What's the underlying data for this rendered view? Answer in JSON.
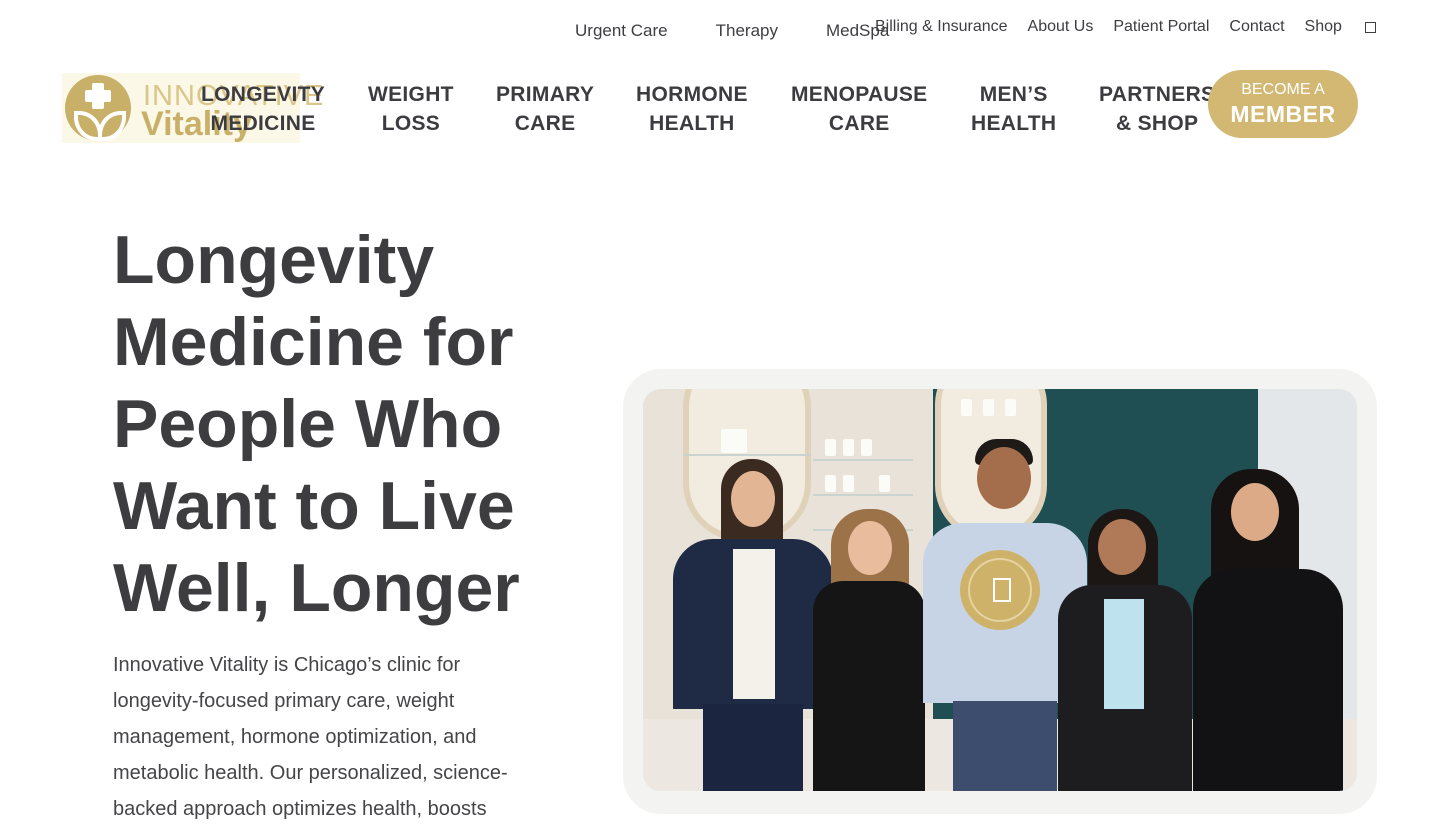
{
  "utility_nav": {
    "left": [
      "Urgent Care",
      "Therapy",
      "MedSpa"
    ],
    "right": [
      "Billing & Insurance",
      "About Us",
      "Patient Portal",
      "Contact",
      "Shop"
    ],
    "extra_icon": "square-icon"
  },
  "logo": {
    "line1": "INNOVATIVE",
    "line2": "Vitality",
    "icon": "cross-leaf-logo-icon"
  },
  "main_nav": [
    {
      "line1": "LONGEVITY",
      "line2": "MEDICINE"
    },
    {
      "line1": "WEIGHT",
      "line2": "LOSS"
    },
    {
      "line1": "PRIMARY",
      "line2": "CARE"
    },
    {
      "line1": "HORMONE",
      "line2": "HEALTH"
    },
    {
      "line1": "MENOPAUSE",
      "line2": "CARE"
    },
    {
      "line1": "MEN’S",
      "line2": "HEALTH"
    },
    {
      "line1": "PARTNERS",
      "line2": "& SHOP"
    }
  ],
  "cta": {
    "line1": "BECOME A",
    "line2": "MEMBER"
  },
  "hero": {
    "title_lines": [
      "Longevity",
      "Medicine for",
      "People Who",
      "Want to Live",
      "Well, Longer"
    ],
    "description_lines": [
      "Innovative Vitality is Chicago’s clinic for",
      "longevity-focused primary care, weight",
      "management, hormone optimization, and",
      "metabolic health. Our personalized, science-",
      "backed approach optimizes health, boosts"
    ]
  },
  "video": {
    "play_icon": "video-play-icon"
  },
  "colors": {
    "gold": "#d3b873",
    "text": "#3d3d40",
    "frame": "#f3f3f2"
  }
}
